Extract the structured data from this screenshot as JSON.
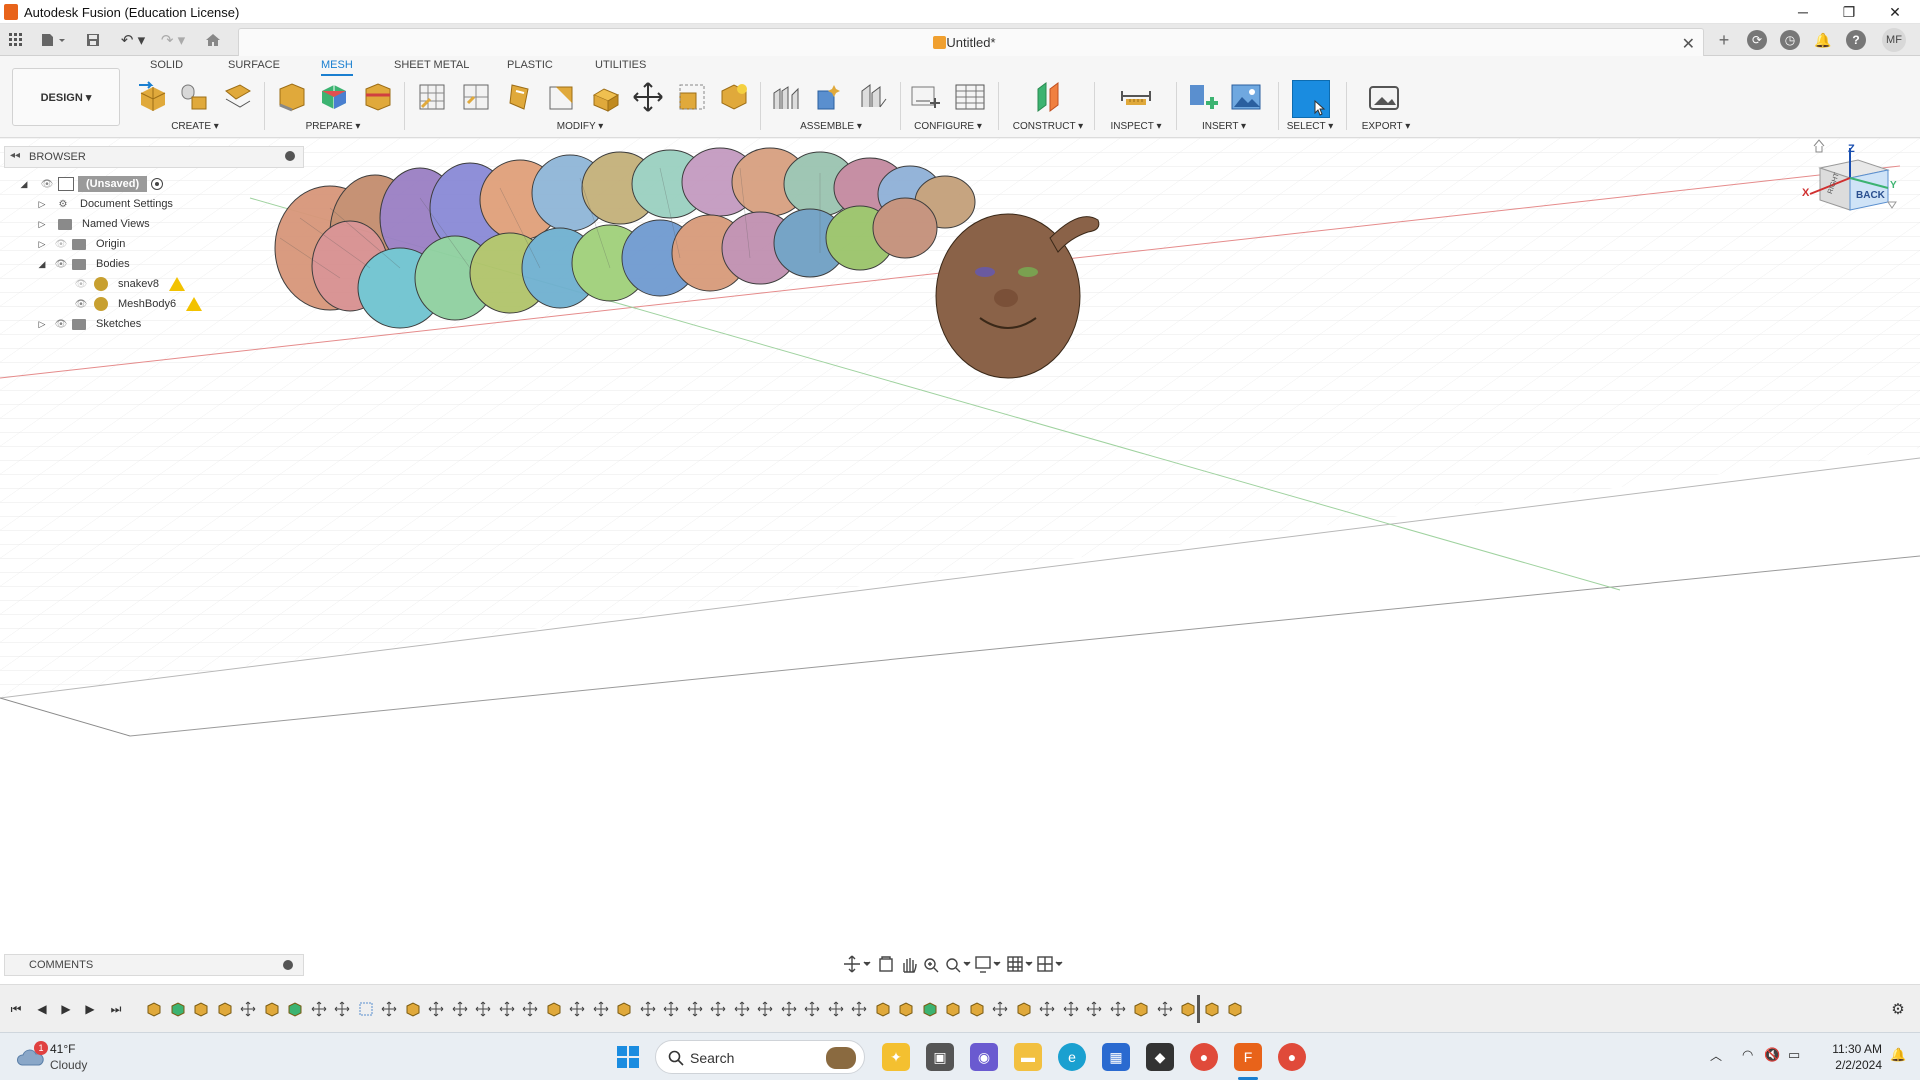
{
  "window": {
    "title": "Autodesk Fusion (Education License)",
    "controls": [
      "─",
      "❐",
      "✕"
    ]
  },
  "document": {
    "title": "Untitled*"
  },
  "user": {
    "initials": "MF"
  },
  "workspace": {
    "label": "DESIGN ▾"
  },
  "tabs": [
    "SOLID",
    "SURFACE",
    "MESH",
    "SHEET METAL",
    "PLASTIC",
    "UTILITIES"
  ],
  "active_tab": "MESH",
  "tool_groups": [
    {
      "label": "CREATE ▾"
    },
    {
      "label": "PREPARE ▾"
    },
    {
      "label": "MODIFY ▾"
    },
    {
      "label": "ASSEMBLE ▾"
    },
    {
      "label": "CONFIGURE ▾"
    },
    {
      "label": "CONSTRUCT ▾"
    },
    {
      "label": "INSPECT ▾"
    },
    {
      "label": "INSERT ▾"
    },
    {
      "label": "SELECT ▾"
    },
    {
      "label": "EXPORT ▾"
    }
  ],
  "browser": {
    "header": "BROWSER",
    "root": "(Unsaved)",
    "items": [
      {
        "label": "Document Settings"
      },
      {
        "label": "Named Views"
      },
      {
        "label": "Origin"
      },
      {
        "label": "Bodies"
      },
      {
        "label": "snakev8"
      },
      {
        "label": "MeshBody6"
      },
      {
        "label": "Sketches"
      }
    ]
  },
  "viewcube": {
    "face": "BACK",
    "side": "RIGHT",
    "axis_z": "Z",
    "axis_x": "X",
    "axis_y": "Y"
  },
  "comments": {
    "header": "COMMENTS"
  },
  "taskbar": {
    "weather_temp": "41°F",
    "weather_desc": "Cloudy",
    "weather_badge": "1",
    "search": "Search",
    "time": "11:30 AM",
    "date": "2/2/2024"
  },
  "colors": {
    "accent": "#1a7fd0",
    "select_highlight": "#1a8ce0",
    "warning": "#f2c200",
    "brand_orange": "#e8631a"
  }
}
